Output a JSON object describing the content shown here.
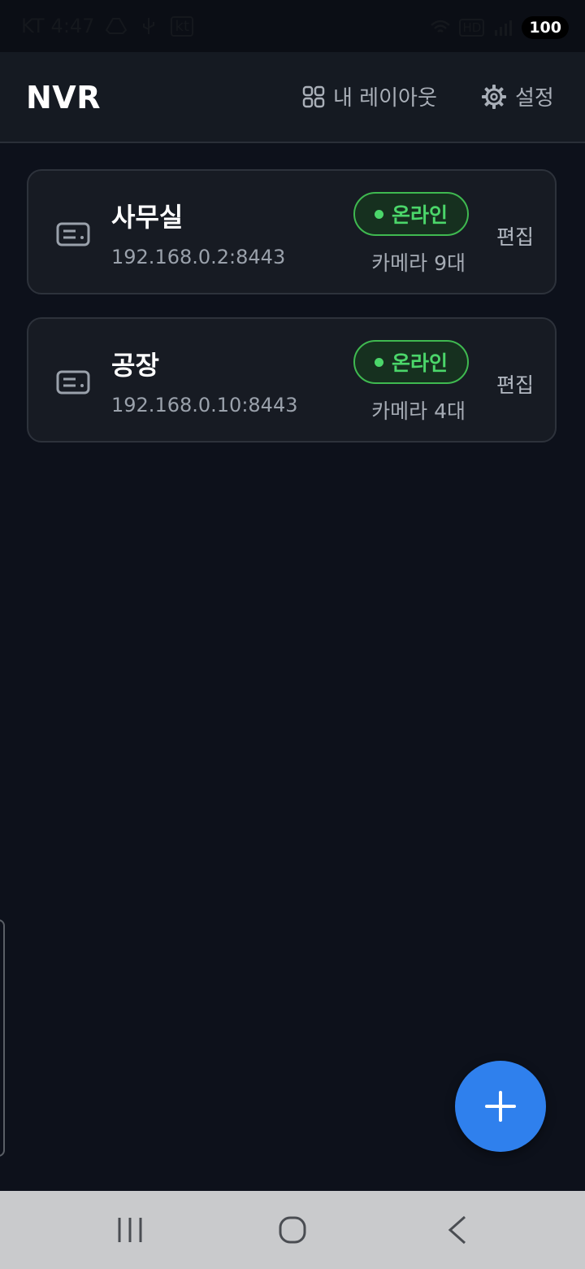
{
  "status_bar": {
    "carrier": "KT",
    "time": "4:47",
    "kt_badge": "kt",
    "hd_badge": "HD",
    "battery": "100"
  },
  "header": {
    "title": "NVR",
    "layout_label": "내 레이아웃",
    "settings_label": "설정"
  },
  "servers": [
    {
      "name": "사무실",
      "address": "192.168.0.2:8443",
      "status": "온라인",
      "cameras": "카메라 9대",
      "edit_label": "편집"
    },
    {
      "name": "공장",
      "address": "192.168.0.10:8443",
      "status": "온라인",
      "cameras": "카메라 4대",
      "edit_label": "편집"
    }
  ],
  "colors": {
    "background": "#0d111b",
    "online": "#4bd66a",
    "fab": "#2f80ed"
  },
  "icons": {
    "server": "server-icon",
    "layout": "grid-icon",
    "settings": "gear-icon",
    "add": "plus-icon"
  }
}
